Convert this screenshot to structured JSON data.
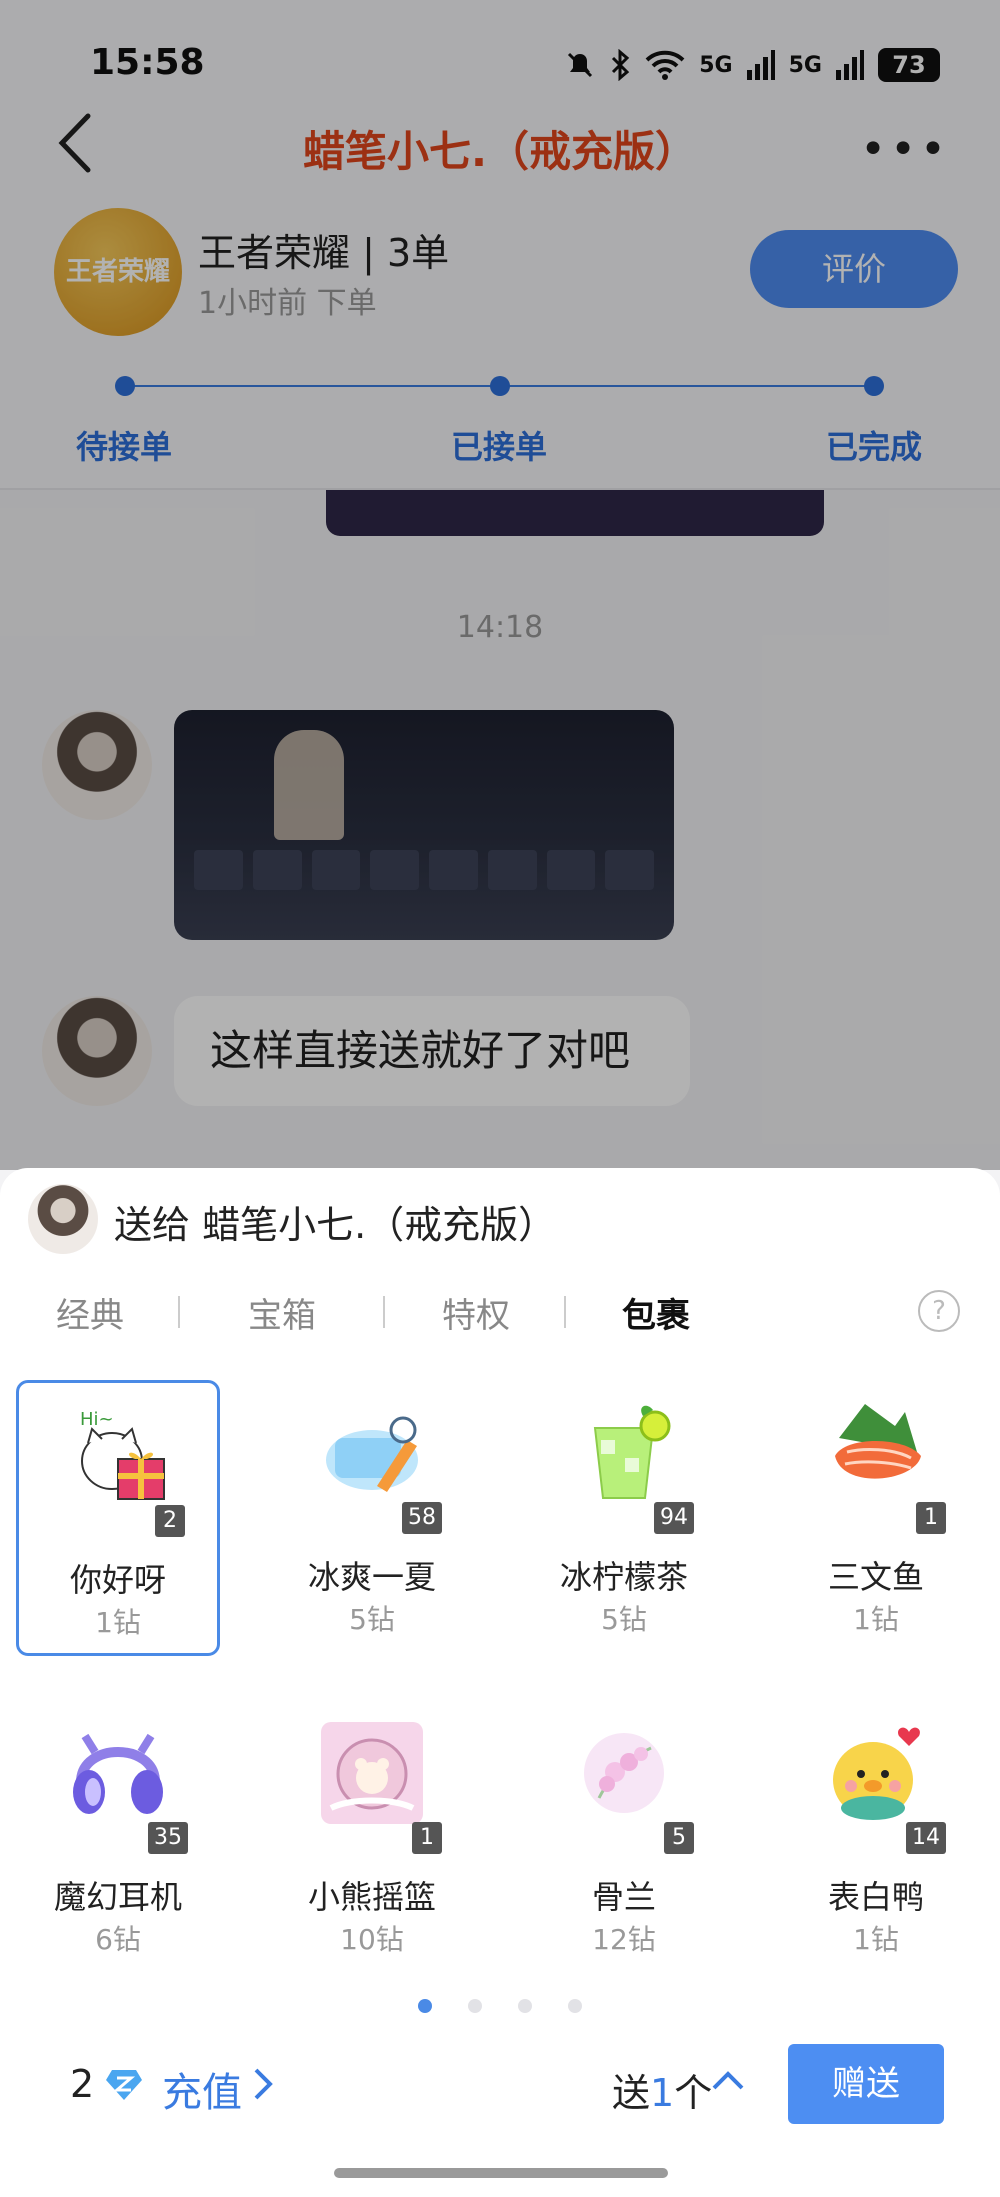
{
  "status_bar": {
    "time": "15:58",
    "network1": "5G",
    "network2": "5G",
    "battery": "73"
  },
  "header": {
    "title": "蜡笔小七.（戒充版）"
  },
  "order": {
    "game_logo_text": "王者荣耀",
    "title": "王者荣耀 | 3单",
    "subtitle": "1小时前 下单",
    "rate_button": "评价",
    "steps": [
      "待接单",
      "已接单",
      "已完成"
    ]
  },
  "chat": {
    "timestamp": "14:18",
    "message_text": "这样直接送就好了对吧"
  },
  "gift_sheet": {
    "send_to": "送给 蜡笔小七.（戒充版）",
    "tabs": [
      "经典",
      "宝箱",
      "特权",
      "包裹"
    ],
    "active_tab": "包裹",
    "help": "?",
    "gifts": [
      {
        "name": "你好呀",
        "price": "1钻",
        "count": "2",
        "icon": "cat-gift-icon",
        "selected": true
      },
      {
        "name": "冰爽一夏",
        "price": "5钻",
        "count": "58",
        "icon": "ice-popsicle-icon"
      },
      {
        "name": "冰柠檬茶",
        "price": "5钻",
        "count": "94",
        "icon": "lemon-tea-icon"
      },
      {
        "name": "三文鱼",
        "price": "1钻",
        "count": "1",
        "icon": "salmon-icon"
      },
      {
        "name": "魔幻耳机",
        "price": "6钻",
        "count": "35",
        "icon": "headphones-icon"
      },
      {
        "name": "小熊摇篮",
        "price": "10钻",
        "count": "1",
        "icon": "bear-cradle-icon"
      },
      {
        "name": "骨兰",
        "price": "12钻",
        "count": "5",
        "icon": "orchid-icon"
      },
      {
        "name": "表白鸭",
        "price": "1钻",
        "count": "14",
        "icon": "duck-heart-icon"
      }
    ],
    "page_index": 1,
    "page_count": 4,
    "balance": "2",
    "recharge_label": "充值",
    "quantity_prefix": "送",
    "quantity_value": "1",
    "quantity_suffix": "个",
    "give_button": "赠送"
  },
  "colors": {
    "accent": "#4d8ef2",
    "title_red": "#e0461c",
    "step_blue": "#2d6fd8"
  }
}
